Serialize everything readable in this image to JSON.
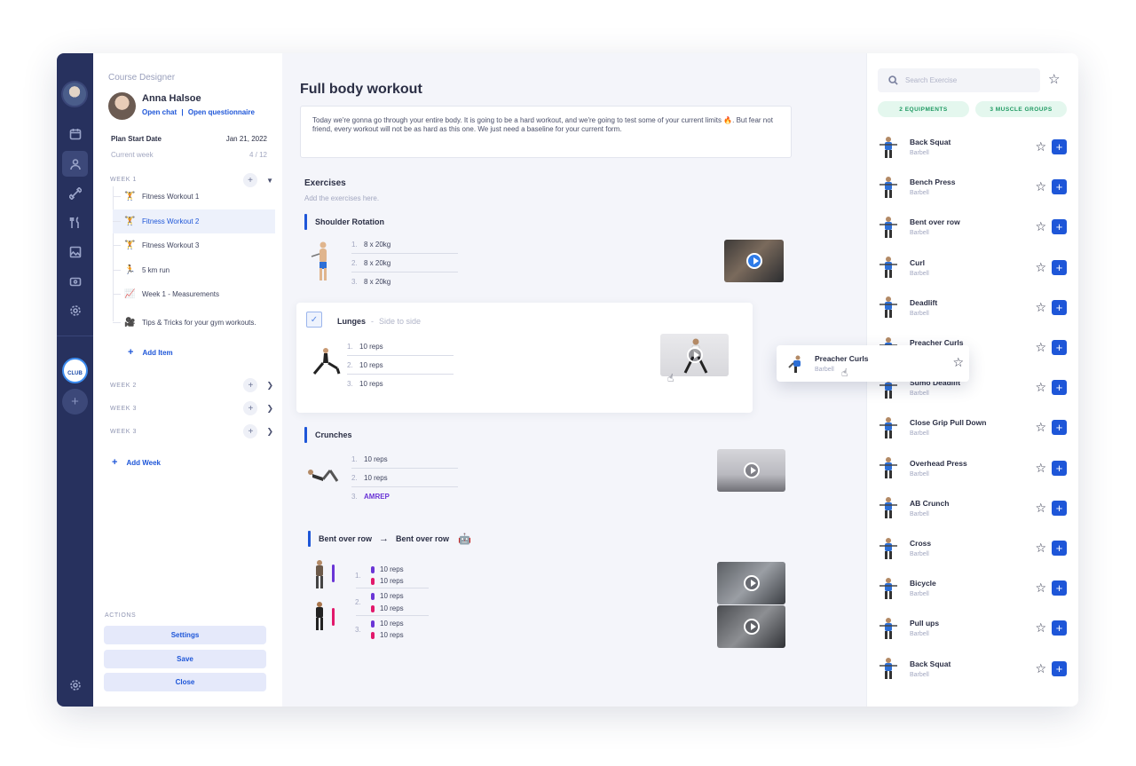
{
  "sidebar_left": {
    "designer_label": "Course Designer",
    "user_name": "Anna Halsoe",
    "link_open_chat": "Open chat",
    "link_separator": "|",
    "link_open_questionnaire": "Open questionnaire",
    "plan_start_label": "Plan Start Date",
    "plan_start_value": "Jan 21, 2022",
    "current_week_label": "Current week",
    "current_week_value": "4 / 12",
    "weeks": [
      {
        "label": "WEEK 1"
      },
      {
        "label": "WEEK 2"
      },
      {
        "label": "WEEK 3"
      },
      {
        "label": "WEEK 3"
      }
    ],
    "week1_items": [
      {
        "label": "Fitness Workout 1",
        "icon": "dumbbell-icon"
      },
      {
        "label": "Fitness Workout 2",
        "icon": "dumbbell-icon"
      },
      {
        "label": "Fitness Workout 3",
        "icon": "dumbbell-icon"
      },
      {
        "label": "5 km run",
        "icon": "runner-icon"
      },
      {
        "label": "Week 1 - Measurements",
        "icon": "chart-icon"
      },
      {
        "label": "Tips & Tricks for your gym workouts.",
        "icon": "video-camera-icon"
      }
    ],
    "add_item": "Add Item",
    "add_week": "Add Week",
    "actions_label": "ACTIONS",
    "btn_settings": "Settings",
    "btn_save": "Save",
    "btn_close": "Close"
  },
  "main": {
    "title": "Full body workout",
    "description": "Today we're gonna go through your entire body. It is going to be a hard workout, and we're going to test some of your current limits 🔥. But fear not friend, every workout will not be as hard as this one. We just need a baseline for your current form.",
    "exercises_label": "Exercises",
    "exercises_hint": "Add the exercises here.",
    "exercises": [
      {
        "name": "Shoulder Rotation",
        "sets": [
          {
            "n": "1.",
            "v": "8 x 20kg"
          },
          {
            "n": "2.",
            "v": "8 x 20kg"
          },
          {
            "n": "3.",
            "v": "8 x 20kg"
          }
        ]
      },
      {
        "name": "Lunges",
        "separator": "-",
        "subtitle": "Side to side",
        "sets": [
          {
            "n": "1.",
            "v": "10 reps"
          },
          {
            "n": "2.",
            "v": "10 reps"
          },
          {
            "n": "3.",
            "v": "10 reps"
          }
        ]
      },
      {
        "name": "Crunches",
        "sets": [
          {
            "n": "1.",
            "v": "10 reps"
          },
          {
            "n": "2.",
            "v": "10 reps"
          },
          {
            "n": "3.",
            "v": "AMREP"
          }
        ]
      }
    ],
    "superset": {
      "first": "Bent over row",
      "arrow": "→",
      "second": "Bent over row",
      "sets": [
        {
          "n": "1.",
          "a": "10 reps",
          "b": "10 reps"
        },
        {
          "n": "2.",
          "a": "10 reps",
          "b": "10 reps"
        },
        {
          "n": "3.",
          "a": "10 reps",
          "b": "10 reps"
        }
      ]
    }
  },
  "library": {
    "search_placeholder": "Search Exercise",
    "chip_equipment": "2 EQUIPMENTS",
    "chip_muscle": "3 MUSCLE GROUPS",
    "items": [
      {
        "name": "Back Squat",
        "equipment": "Barbell"
      },
      {
        "name": "Bench Press",
        "equipment": "Barbell"
      },
      {
        "name": "Bent over row",
        "equipment": "Barbell"
      },
      {
        "name": "Curl",
        "equipment": "Barbell"
      },
      {
        "name": "Deadlift",
        "equipment": "Barbell"
      },
      {
        "name": "Preacher Curls",
        "equipment": "Barbell"
      },
      {
        "name": "Sumo Deadlift",
        "equipment": "Barbell"
      },
      {
        "name": "Close Grip Pull Down",
        "equipment": "Barbell"
      },
      {
        "name": "Overhead Press",
        "equipment": "Barbell"
      },
      {
        "name": "AB Crunch",
        "equipment": "Barbell"
      },
      {
        "name": "Cross",
        "equipment": "Barbell"
      },
      {
        "name": "Bicycle",
        "equipment": "Barbell"
      },
      {
        "name": "Pull ups",
        "equipment": "Barbell"
      },
      {
        "name": "Back Squat",
        "equipment": "Barbell"
      }
    ],
    "dragging": {
      "name": "Preacher Curls",
      "equipment": "Barbell"
    }
  },
  "colors": {
    "accent": "#1e56d8",
    "rail": "#27315e",
    "chip_green": "#1f9a62",
    "superset_purple": "#6a35d6",
    "superset_magenta": "#e2186b"
  }
}
